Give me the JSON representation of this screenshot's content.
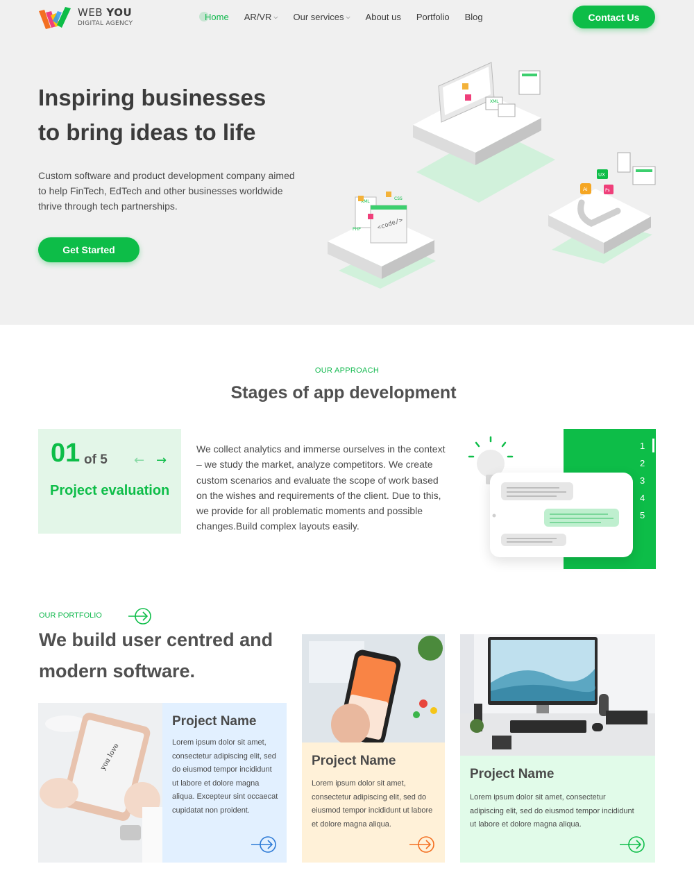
{
  "header": {
    "logo_name_light": "WEB ",
    "logo_name_bold": "YOU",
    "logo_sub": "DIGITAL AGENCY",
    "nav": [
      {
        "label": "Home",
        "dropdown": false,
        "active": true
      },
      {
        "label": "AR/VR",
        "dropdown": true,
        "active": false
      },
      {
        "label": "Our services",
        "dropdown": true,
        "active": false
      },
      {
        "label": "About us",
        "dropdown": false,
        "active": false
      },
      {
        "label": "Portfolio",
        "dropdown": false,
        "active": false
      },
      {
        "label": "Blog",
        "dropdown": false,
        "active": false
      }
    ],
    "contact_label": "Contact Us"
  },
  "hero": {
    "title_line1": "Inspiring businesses",
    "title_line2": "to bring ideas to life",
    "description": "Custom software and product development company aimed to help FinTech, EdTech and other businesses worldwide thrive through tech partnerships.",
    "cta_label": "Get Started",
    "illustration_tags": [
      "XML",
      "CSS",
      "PHP",
      "<code/>",
      "UX",
      "Ai",
      "Ps",
      "XML"
    ]
  },
  "approach": {
    "eyebrow": "OUR APPROACH",
    "title": "Stages of app development",
    "stage_number": "01",
    "stage_total": "of 5",
    "stage_name": "Project evaluation",
    "stage_text": "We collect analytics and immerse ourselves in the context – we study the market, analyze competitors. We create custom scenarios and evaluate the scope of work based on the wishes and requirements of the client. Due to this, we provide for all problematic moments and possible changes.Build complex layouts easily.",
    "steps": [
      "1",
      "2",
      "3",
      "4",
      "5"
    ],
    "active_step": 1
  },
  "portfolio": {
    "eyebrow": "OUR PORTFOLIO",
    "title": "We build user centred and modern software.",
    "projects": [
      {
        "title": "Project Name",
        "text": "Lorem ipsum dolor sit amet, consectetur adipiscing elit, sed do eiusmod tempor incididunt ut labore et dolore magna aliqua. Excepteur sint occaecat cupidatat non proident."
      },
      {
        "title": "Project Name",
        "text": "Lorem ipsum dolor sit amet, consectetur adipiscing elit, sed do eiusmod tempor incididunt ut labore et dolore magna aliqua."
      },
      {
        "title": "Project Name",
        "text": "Lorem ipsum dolor sit amet, consectetur adipiscing elit, sed do eiusmod tempor incididunt ut labore et dolore magna aliqua."
      }
    ]
  },
  "colors": {
    "brand_green": "#0dbd48",
    "hero_bg": "#f0f0f0",
    "card_blue": "#e2f0ff",
    "card_yellow": "#fff1d8",
    "card_green": "#e1fbe9",
    "accent_orange": "#f36f21",
    "accent_blue": "#2d7ad6"
  },
  "icons": [
    "logo-w-icon",
    "chevron-down-icon",
    "arrow-left-icon",
    "arrow-right-icon",
    "circle-arrow-right-icon",
    "lightbulb-icon"
  ]
}
